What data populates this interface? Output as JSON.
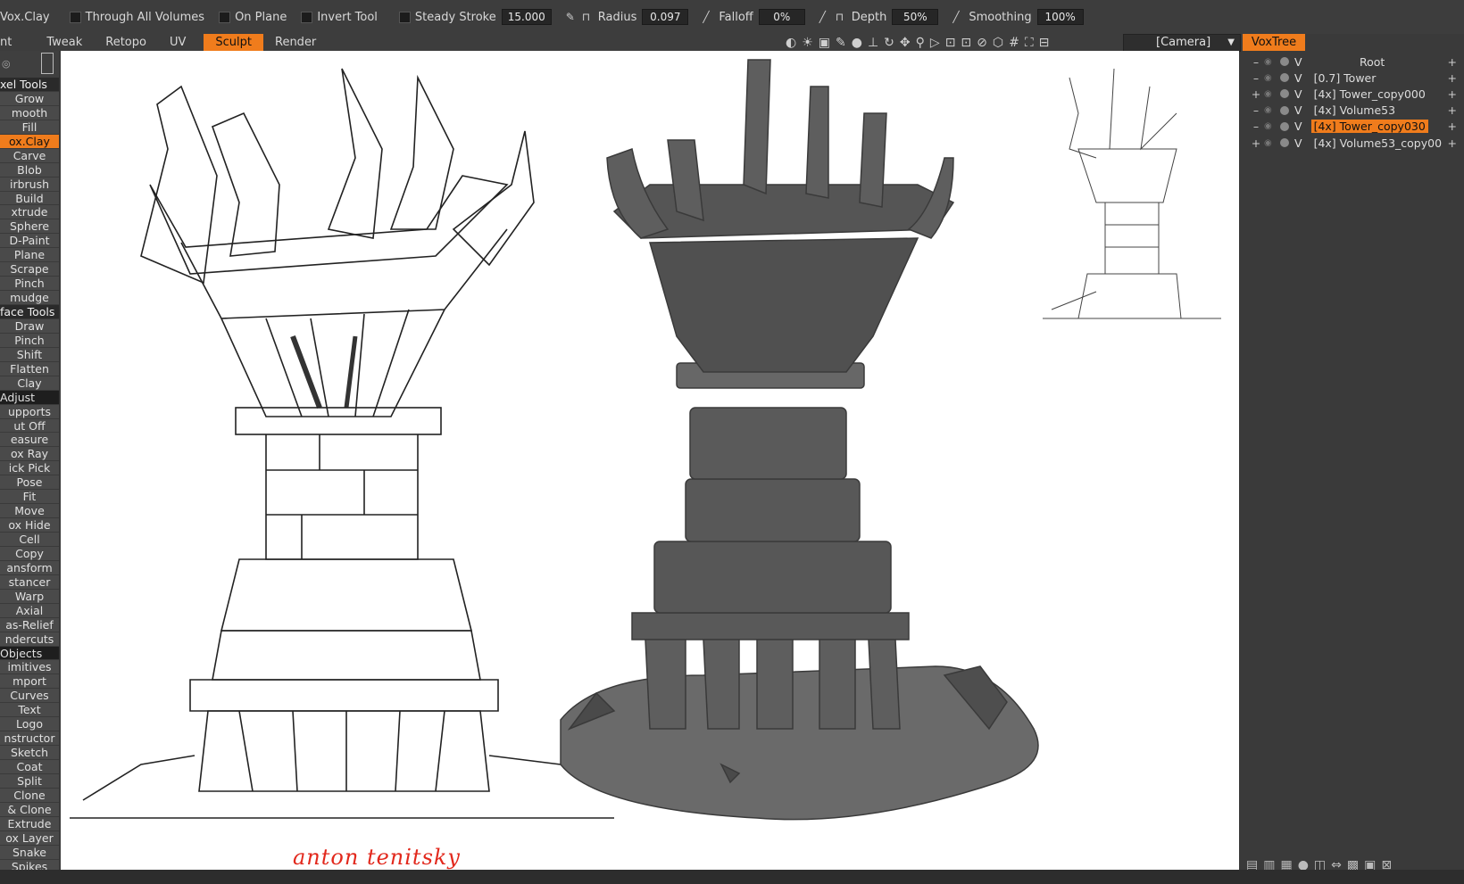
{
  "toolbar": {
    "tool_name": "Vox.Clay",
    "through_all_volumes": "Through  All  Volumes",
    "on_plane": "On  Plane",
    "invert_tool": "Invert  Tool",
    "steady_stroke_label": "Steady  Stroke",
    "steady_stroke_value": "15.000",
    "radius_label": "Radius",
    "radius_value": "0.097",
    "falloff_label": "Falloff",
    "falloff_value": "0%",
    "depth_label": "Depth",
    "depth_value": "50%",
    "smoothing_label": "Smoothing",
    "smoothing_value": "100%"
  },
  "tabs": [
    {
      "label": "nt"
    },
    {
      "label": "Tweak"
    },
    {
      "label": "Retopo"
    },
    {
      "label": "UV"
    },
    {
      "label": "Sculpt",
      "active": true
    },
    {
      "label": "Render"
    }
  ],
  "camera": {
    "label": "[Camera]"
  },
  "voxtree": {
    "title": "VoxTree",
    "items": [
      {
        "expander": "–",
        "v": "V",
        "name": "Root",
        "selected": false
      },
      {
        "expander": "–",
        "v": "V",
        "name": "[0.7] Tower",
        "selected": false
      },
      {
        "expander": "+",
        "v": "V",
        "name": "[4x] Tower_copy000",
        "selected": false
      },
      {
        "expander": "–",
        "v": "V",
        "name": "[4x] Volume53",
        "selected": false
      },
      {
        "expander": "–",
        "v": "V",
        "name": "[4x] Tower_copy030",
        "selected": true
      },
      {
        "expander": "+",
        "v": "V",
        "name": "[4x] Volume53_copy00",
        "selected": false
      }
    ]
  },
  "sidebar": {
    "items": [
      {
        "label": "xel  Tools",
        "kind": "header"
      },
      {
        "label": "Grow"
      },
      {
        "label": "mooth"
      },
      {
        "label": "Fill"
      },
      {
        "label": "ox.Clay",
        "kind": "active"
      },
      {
        "label": "Carve"
      },
      {
        "label": "Blob"
      },
      {
        "label": "irbrush"
      },
      {
        "label": "Build"
      },
      {
        "label": "xtrude"
      },
      {
        "label": "Sphere"
      },
      {
        "label": "D-Paint"
      },
      {
        "label": "Plane"
      },
      {
        "label": "Scrape"
      },
      {
        "label": "Pinch"
      },
      {
        "label": "mudge"
      },
      {
        "label": "face  Tools",
        "kind": "header"
      },
      {
        "label": "Draw"
      },
      {
        "label": "Pinch"
      },
      {
        "label": "Shift"
      },
      {
        "label": "Flatten"
      },
      {
        "label": "Clay"
      },
      {
        "label": "Adjust",
        "kind": "sub"
      },
      {
        "label": "upports"
      },
      {
        "label": "ut  Off"
      },
      {
        "label": "easure"
      },
      {
        "label": "ox  Ray"
      },
      {
        "label": "ick  Pick"
      },
      {
        "label": "Pose"
      },
      {
        "label": "Fit"
      },
      {
        "label": "Move"
      },
      {
        "label": "ox  Hide"
      },
      {
        "label": "Cell"
      },
      {
        "label": "Copy"
      },
      {
        "label": "ansform"
      },
      {
        "label": "stancer"
      },
      {
        "label": "Warp"
      },
      {
        "label": "Axial"
      },
      {
        "label": "as-Relief"
      },
      {
        "label": "ndercuts"
      },
      {
        "label": "Objects",
        "kind": "sub"
      },
      {
        "label": "imitives"
      },
      {
        "label": "mport"
      },
      {
        "label": "Curves"
      },
      {
        "label": "Text"
      },
      {
        "label": "Logo"
      },
      {
        "label": "nstructor"
      },
      {
        "label": "Sketch"
      },
      {
        "label": "Coat"
      },
      {
        "label": "Split"
      },
      {
        "label": "Clone"
      },
      {
        "label": "&  Clone"
      },
      {
        "label": "Extrude"
      },
      {
        "label": "ox  Layer"
      },
      {
        "label": "Snake"
      },
      {
        "label": "Spikes"
      }
    ]
  },
  "viewport": {
    "signature": "anton tenitsky"
  },
  "colors": {
    "accent": "#f07c1c",
    "panel": "#3d3d3d",
    "model": "#5e5e5e"
  }
}
